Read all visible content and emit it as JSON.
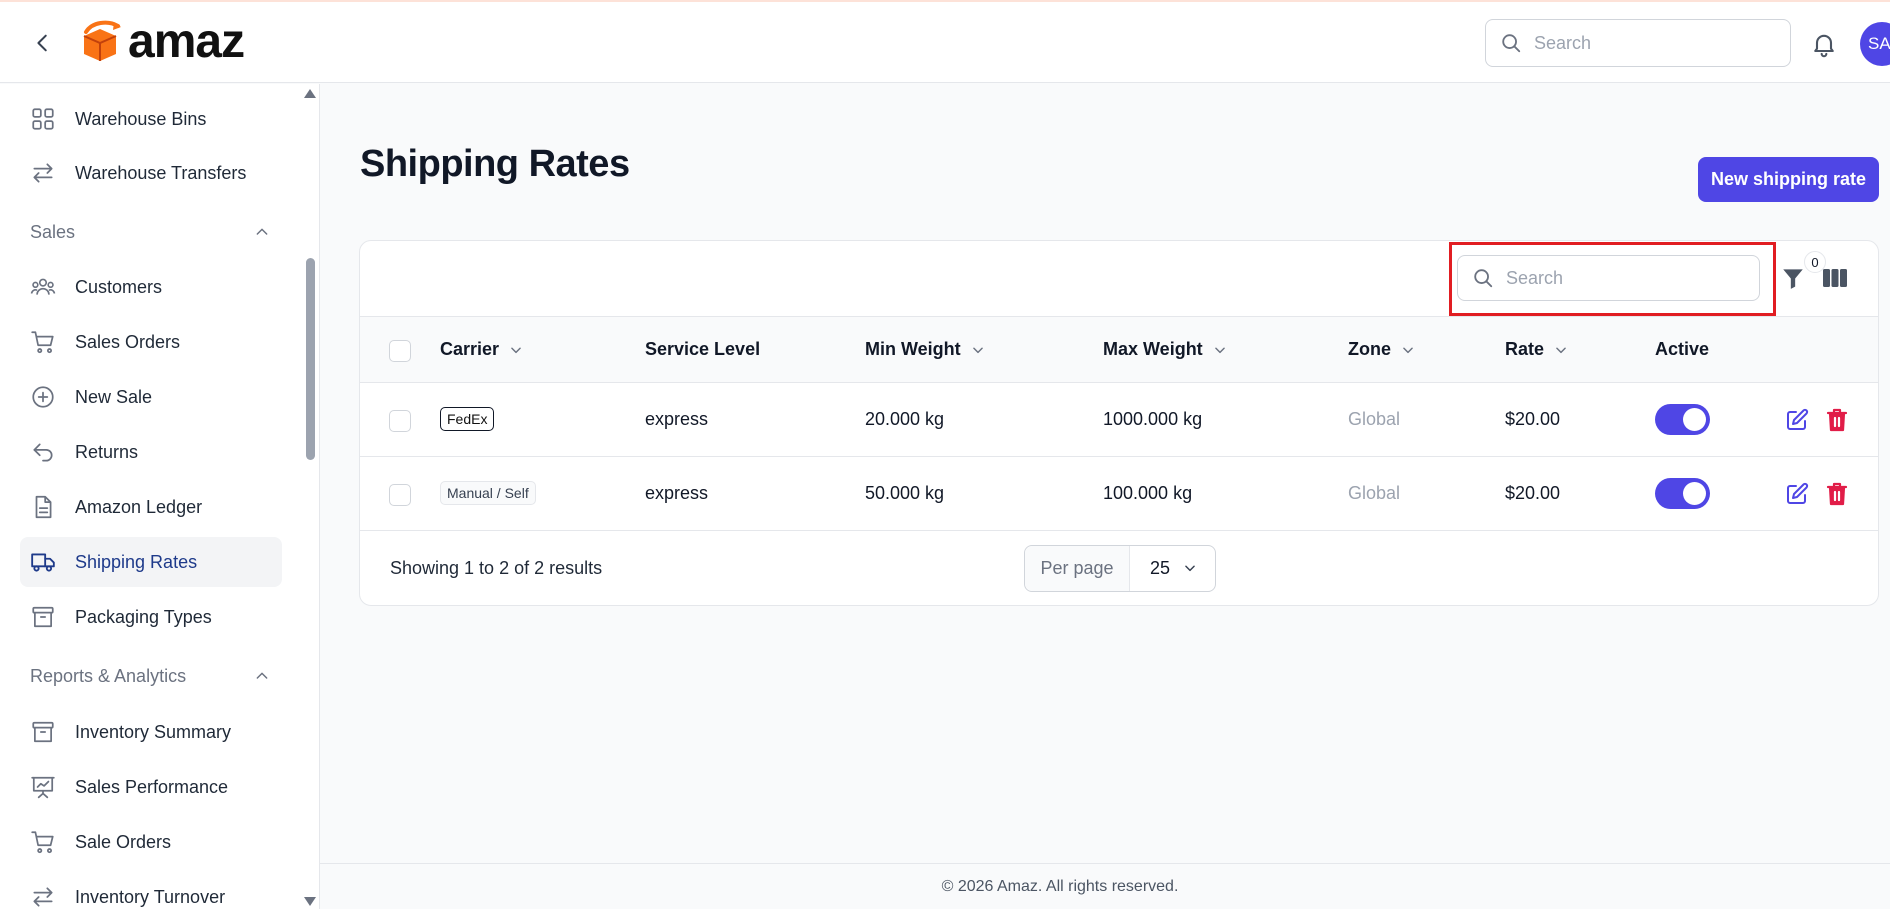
{
  "header": {
    "logo_text": "amaz",
    "search_placeholder": "Search",
    "avatar_initials": "SA"
  },
  "sidebar": {
    "items_top": [
      {
        "label": "Warehouse Bins",
        "icon": "grid-icon"
      },
      {
        "label": "Warehouse Transfers",
        "icon": "arrows-left-right-icon"
      }
    ],
    "section_sales": "Sales",
    "sales_items": [
      {
        "label": "Customers",
        "icon": "users-icon"
      },
      {
        "label": "Sales Orders",
        "icon": "cart-icon"
      },
      {
        "label": "New Sale",
        "icon": "plus-circle-icon"
      },
      {
        "label": "Returns",
        "icon": "return-arrow-icon"
      },
      {
        "label": "Amazon Ledger",
        "icon": "document-icon"
      },
      {
        "label": "Shipping Rates",
        "icon": "truck-icon",
        "active": true
      },
      {
        "label": "Packaging Types",
        "icon": "archive-box-icon"
      }
    ],
    "section_reports": "Reports & Analytics",
    "report_items": [
      {
        "label": "Inventory Summary",
        "icon": "archive-box-icon"
      },
      {
        "label": "Sales Performance",
        "icon": "presentation-chart-icon"
      },
      {
        "label": "Sale Orders",
        "icon": "cart-icon"
      },
      {
        "label": "Inventory Turnover",
        "icon": "arrows-left-right-icon"
      }
    ]
  },
  "page": {
    "title": "Shipping Rates",
    "new_button": "New shipping rate"
  },
  "table": {
    "search_placeholder": "Search",
    "filter_count": "0",
    "columns": [
      "Carrier",
      "Service Level",
      "Min Weight",
      "Max Weight",
      "Zone",
      "Rate",
      "Active"
    ],
    "rows": [
      {
        "carrier": "FedEx",
        "service_level": "express",
        "min_weight": "20.000 kg",
        "max_weight": "1000.000 kg",
        "zone": "Global",
        "rate": "$20.00",
        "active": true
      },
      {
        "carrier": "Manual / Self",
        "service_level": "express",
        "min_weight": "50.000 kg",
        "max_weight": "100.000 kg",
        "zone": "Global",
        "rate": "$20.00",
        "active": true
      }
    ],
    "showing": "Showing 1 to 2 of 2 results",
    "per_page_label": "Per page",
    "per_page_value": "25"
  },
  "footer": "© 2026 Amaz. All rights reserved.",
  "colors": {
    "accent": "#4f46e5",
    "danger": "#e11d48",
    "highlight": "#e11d22",
    "logo_orange": "#f97316"
  }
}
